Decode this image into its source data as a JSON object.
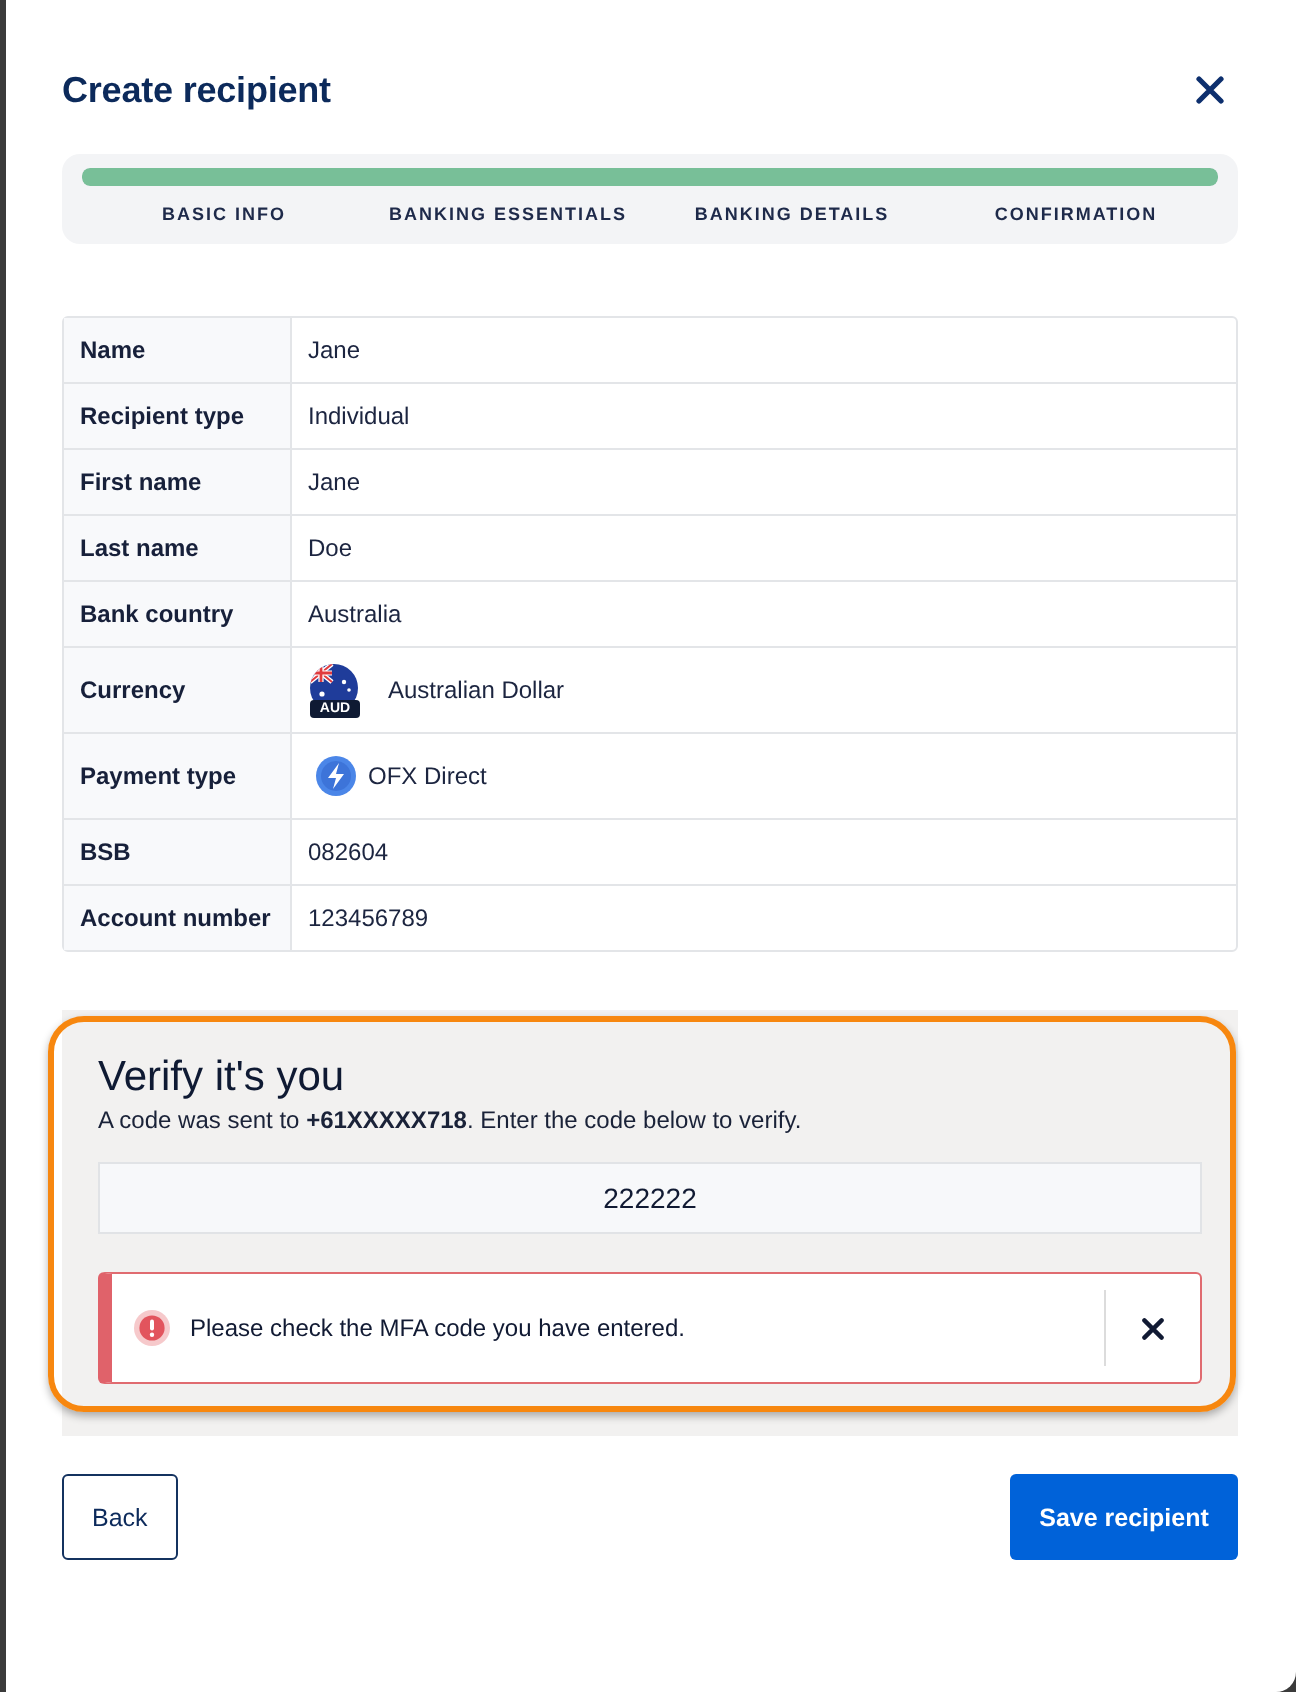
{
  "dialog": {
    "title": "Create recipient"
  },
  "progress": {
    "level": 1,
    "steps": [
      {
        "label": "BASIC INFO"
      },
      {
        "label": "BANKING ESSENTIALS"
      },
      {
        "label": "BANKING DETAILS"
      },
      {
        "label": "CONFIRMATION"
      }
    ]
  },
  "details": {
    "rows": [
      {
        "label": "Name",
        "value": "Jane",
        "kind": "text"
      },
      {
        "label": "Recipient type",
        "value": "Individual",
        "kind": "text"
      },
      {
        "label": "First name",
        "value": "Jane",
        "kind": "text"
      },
      {
        "label": "Last name",
        "value": "Doe",
        "kind": "text"
      },
      {
        "label": "Bank country",
        "value": "Australia",
        "kind": "text"
      },
      {
        "label": "Currency",
        "value": "Australian Dollar",
        "kind": "currency",
        "badge": "AUD"
      },
      {
        "label": "Payment type",
        "value": "OFX Direct",
        "kind": "payment"
      },
      {
        "label": "BSB",
        "value": "082604",
        "kind": "text"
      },
      {
        "label": "Account number",
        "value": "123456789",
        "kind": "text"
      }
    ]
  },
  "verify": {
    "highlighted": true,
    "title": "Verify it's you",
    "message": "A code was sent to **+61XXXXX718**. Enter the code below to verify.",
    "code": {
      "value": "222222"
    },
    "alert": {
      "kind": "error",
      "text": "Please check the MFA code you have entered.",
      "dismissible": true
    }
  },
  "buttons": [
    {
      "label": "Back",
      "kind": "secondary"
    },
    {
      "label": "Save recipient",
      "kind": "primary"
    }
  ]
}
